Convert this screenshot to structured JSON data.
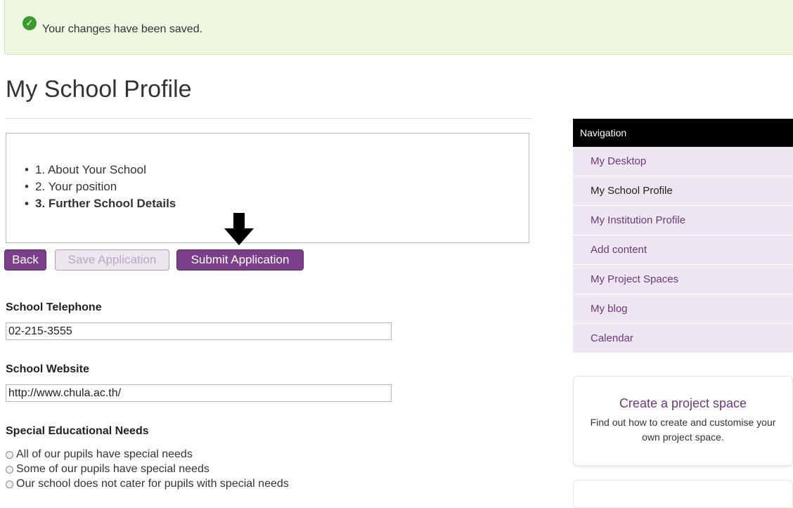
{
  "banner": {
    "message": "Your changes have been saved."
  },
  "page": {
    "title": "My School Profile"
  },
  "steps": [
    {
      "label": "1. About Your School",
      "current": false
    },
    {
      "label": "2. Your position",
      "current": false
    },
    {
      "label": "3. Further School Details",
      "current": true
    }
  ],
  "buttons": {
    "back": "Back",
    "save": "Save Application",
    "submit": "Submit Application"
  },
  "form": {
    "telephone": {
      "label": "School Telephone",
      "value": "02-215-3555"
    },
    "website": {
      "label": "School Website",
      "value": "http://www.chula.ac.th/"
    },
    "special_needs": {
      "label": "Special Educational Needs",
      "options": [
        "All of our pupils have special needs",
        "Some of our pupils have special needs",
        "Our school does not cater for pupils with special needs"
      ]
    }
  },
  "nav": {
    "header": "Navigation",
    "items": [
      {
        "label": "My Desktop",
        "active": false
      },
      {
        "label": "My School Profile",
        "active": true
      },
      {
        "label": "My Institution Profile",
        "active": false
      },
      {
        "label": "Add content",
        "active": false
      },
      {
        "label": "My Project Spaces",
        "active": false
      },
      {
        "label": "My blog",
        "active": false
      },
      {
        "label": "Calendar",
        "active": false
      }
    ]
  },
  "promo": {
    "title": "Create a project space",
    "text": "Find out how to create and customise your own project space."
  },
  "colors": {
    "accent": "#7b3f8a",
    "banner_bg": "#eef8e1",
    "success": "#3c9a2f"
  }
}
